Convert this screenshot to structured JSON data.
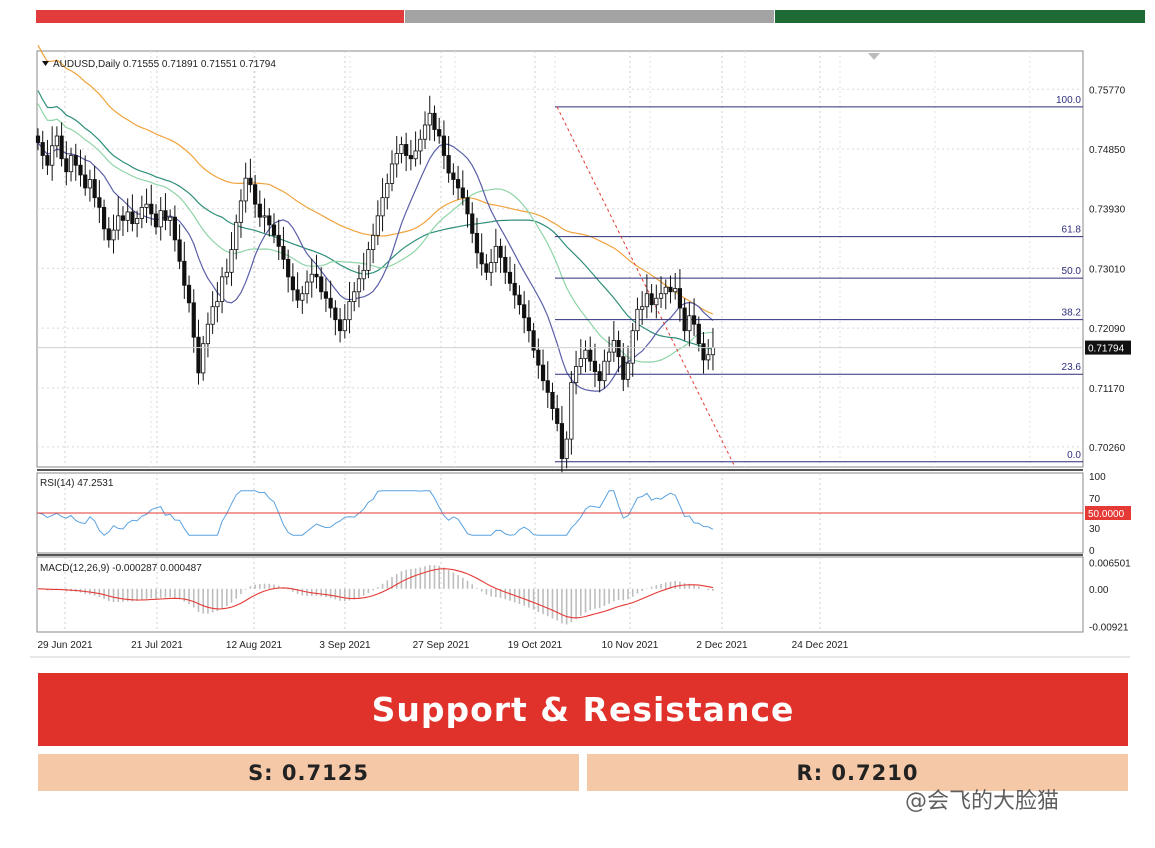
{
  "top_bar_colors": [
    "#e13b3b",
    "#a3a3a3",
    "#1e6b35"
  ],
  "chart_data": [
    {
      "type": "candlestick",
      "symbol_label": "AUDUSD,Daily",
      "ohlc_label": "0.71555 0.71891 0.71551 0.71794",
      "last_price_label": "0.71794",
      "y_tick_labels": [
        "0.75770",
        "0.74850",
        "0.73930",
        "0.73010",
        "0.72090",
        "0.71170",
        "0.70260"
      ],
      "y_ticks": [
        0.7577,
        0.7485,
        0.7393,
        0.7301,
        0.7209,
        0.7117,
        0.7026
      ],
      "ylim": [
        0.6995,
        0.7636
      ],
      "x_labels": [
        "29 Jun 2021",
        "21 Jul 2021",
        "12 Aug 2021",
        "3 Sep 2021",
        "27 Sep 2021",
        "19 Oct 2021",
        "10 Nov 2021",
        "2 Dec 2021",
        "24 Dec 2021"
      ],
      "fibonacci": [
        {
          "label": "100.0",
          "price": 0.755
        },
        {
          "label": "61.8",
          "price": 0.735
        },
        {
          "label": "50.0",
          "price": 0.7286
        },
        {
          "label": "38.2",
          "price": 0.7222
        },
        {
          "label": "23.6",
          "price": 0.7138
        },
        {
          "label": "0.0",
          "price": 0.7003
        }
      ],
      "closes": [
        0.7495,
        0.7475,
        0.746,
        0.749,
        0.7505,
        0.747,
        0.745,
        0.7475,
        0.746,
        0.7445,
        0.7425,
        0.7438,
        0.741,
        0.7395,
        0.7362,
        0.7345,
        0.736,
        0.7382,
        0.7375,
        0.7388,
        0.737,
        0.7378,
        0.7395,
        0.74,
        0.7385,
        0.7365,
        0.739,
        0.7375,
        0.738,
        0.7345,
        0.7312,
        0.7275,
        0.7248,
        0.7195,
        0.714,
        0.7185,
        0.7215,
        0.7242,
        0.725,
        0.7288,
        0.7295,
        0.733,
        0.7372,
        0.7405,
        0.744,
        0.743,
        0.74,
        0.738,
        0.7382,
        0.7368,
        0.7352,
        0.7335,
        0.7315,
        0.7288,
        0.7268,
        0.7252,
        0.7262,
        0.728,
        0.7292,
        0.7288,
        0.7265,
        0.7255,
        0.724,
        0.7222,
        0.7205,
        0.7222,
        0.725,
        0.7265,
        0.7285,
        0.7298,
        0.733,
        0.7352,
        0.7382,
        0.741,
        0.7432,
        0.7462,
        0.7478,
        0.7492,
        0.7475,
        0.747,
        0.7482,
        0.75,
        0.7522,
        0.754,
        0.7515,
        0.7505,
        0.7475,
        0.7448,
        0.7438,
        0.7425,
        0.741,
        0.7385,
        0.7355,
        0.7325,
        0.7308,
        0.7295,
        0.731,
        0.7335,
        0.7318,
        0.7295,
        0.7278,
        0.726,
        0.7245,
        0.7225,
        0.7205,
        0.7175,
        0.7152,
        0.7128,
        0.711,
        0.7085,
        0.7062,
        0.7008,
        0.7038,
        0.7125,
        0.715,
        0.7162,
        0.7175,
        0.7158,
        0.7142,
        0.7128,
        0.7158,
        0.7172,
        0.719,
        0.7165,
        0.713,
        0.7155,
        0.7205,
        0.7238,
        0.7242,
        0.7262,
        0.7245,
        0.7255,
        0.7262,
        0.7272,
        0.7265,
        0.727,
        0.724,
        0.7205,
        0.7228,
        0.7215,
        0.7185,
        0.716,
        0.7168,
        0.7179
      ],
      "indicator_rsi": {
        "label": "RSI(14) 47.2531",
        "y_tick_labels": [
          "100",
          "70",
          "30",
          "0"
        ],
        "ylim": [
          0,
          100
        ],
        "level_label": "50.0000",
        "level": 50
      },
      "indicator_macd": {
        "label": "MACD(12,26,9) -0.000287 0.000487",
        "y_tick_labels": [
          "0.006501",
          "0.00",
          "-0.00921"
        ],
        "y_ticks": [
          0.006501,
          0,
          -0.00921
        ],
        "ylim": [
          -0.0106,
          0.0078
        ]
      },
      "colors": {
        "candle": "#111111",
        "ma_short": "#5a5fa8",
        "ma_mid": "#2f8f7a",
        "ma_light": "#8fd4a8",
        "ma_long": "#f0a23c",
        "fib_line": "#2d2f7a",
        "rsi_line": "#5aa2e0",
        "rsi_level": "#e53935",
        "macd_signal": "#e53935",
        "macd_hist": "#bdbdbd",
        "trend_line": "#e53935"
      }
    }
  ],
  "sr": {
    "title": "Support & Resistance",
    "support": "S: 0.7125",
    "resistance": "R: 0.7210",
    "banner_color": "#e0312a",
    "box_color": "#f5c8a8"
  },
  "watermark": "@会飞的大脸猫"
}
